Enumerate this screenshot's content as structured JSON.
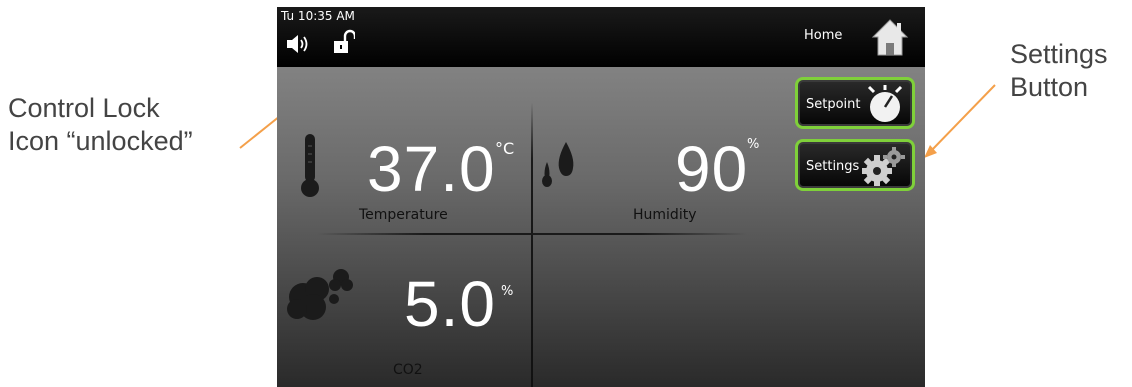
{
  "status_bar": {
    "clock": "Tu 10:35 AM",
    "home_label": "Home"
  },
  "side_buttons": {
    "setpoint_label": "Setpoint",
    "settings_label": "Settings"
  },
  "readings": {
    "temperature": {
      "value": "37.0",
      "unit": "°C",
      "label": "Temperature"
    },
    "humidity": {
      "value": "90",
      "unit": "%",
      "label": "Humidity"
    },
    "co2": {
      "value": "5.0",
      "unit": "%",
      "label": "CO2"
    }
  },
  "annotations": {
    "left_line1": "Control Lock",
    "left_line2": "Icon “unlocked”",
    "right_line1": "Settings",
    "right_line2": "Button"
  },
  "colors": {
    "button_border": "#7fd03a",
    "arrow": "#f4a04a",
    "callout_text": "#444444"
  },
  "icons": [
    "speaker-icon",
    "unlocked-padlock-icon",
    "home-icon",
    "timer-icon",
    "gears-icon",
    "thermometer-icon",
    "water-drops-icon",
    "cloud-icon"
  ]
}
